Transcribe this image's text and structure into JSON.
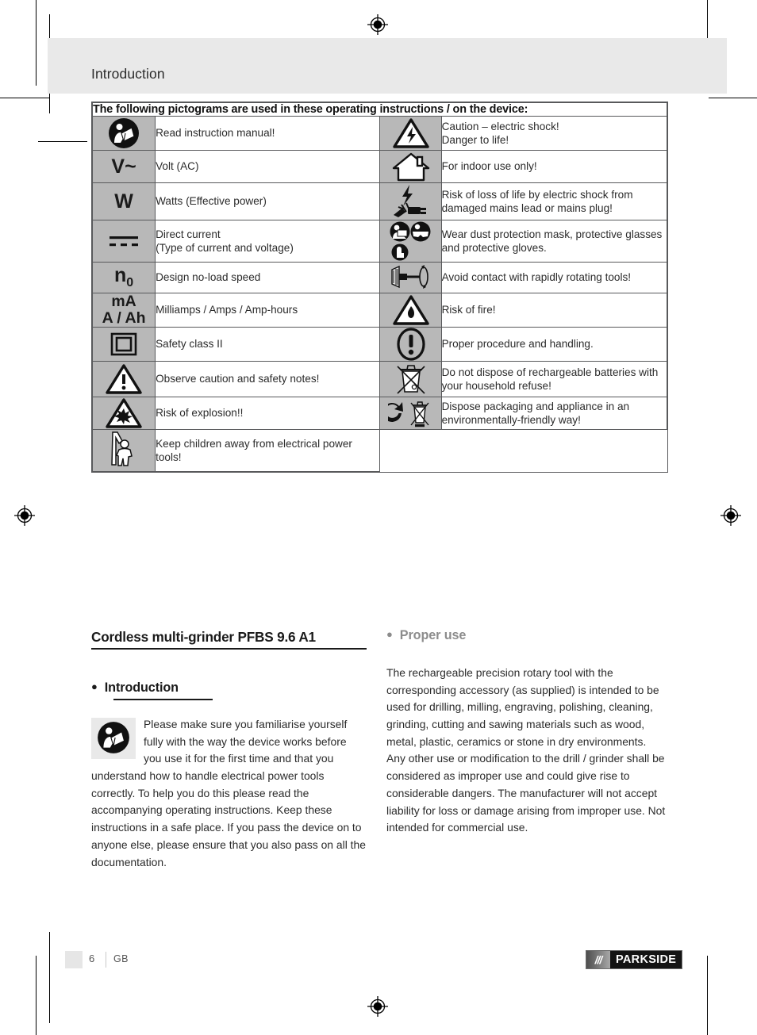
{
  "page": {
    "running_head": "Introduction",
    "footer": {
      "page_number": "6",
      "language": "GB",
      "brand_slashes": "///",
      "brand_name": "PARKSIDE"
    }
  },
  "pictogram_table": {
    "caption": "The following pictograms are used in these operating instructions / on the device:",
    "rows": [
      {
        "left_icon": "read-manual-icon",
        "left_symbol": "",
        "left_text": "Read instruction manual!",
        "right_icon": "electric-shock-warning-icon",
        "right_text": "Caution – electric shock!\nDanger to life!"
      },
      {
        "left_icon": "volt-ac-symbol",
        "left_symbol": "V~",
        "left_text": "Volt (AC)",
        "right_icon": "indoor-use-only-icon",
        "right_text": "For indoor use only!"
      },
      {
        "left_icon": "watts-symbol",
        "left_symbol": "W",
        "left_text": "Watts (Effective power)",
        "right_icon": "damaged-mains-lead-icon",
        "right_text": "Risk of loss of life by electric shock from damaged mains lead or mains plug!"
      },
      {
        "left_icon": "direct-current-symbol",
        "left_symbol": "",
        "left_text": "Direct current\n(Type of current and voltage)",
        "right_icon": "wear-protection-icon",
        "right_text": "Wear dust protection mask, protective glasses and protective gloves."
      },
      {
        "left_icon": "no-load-speed-symbol",
        "left_symbol": "n0",
        "left_text": "Design no-load speed",
        "right_icon": "rotating-tool-warning-icon",
        "right_text": "Avoid contact with rapidly rotating tools!"
      },
      {
        "left_icon": "milliamps-symbol",
        "left_symbol": "mA A / Ah",
        "left_text": "Milliamps / Amps / Amp-hours",
        "right_icon": "fire-risk-icon",
        "right_text": "Risk of fire!"
      },
      {
        "left_icon": "safety-class-two-icon",
        "left_symbol": "",
        "left_text": "Safety class II",
        "right_icon": "proper-handling-icon",
        "right_text": "Proper procedure and handling."
      },
      {
        "left_icon": "general-warning-icon",
        "left_symbol": "",
        "left_text": "Observe caution and safety notes!",
        "right_icon": "no-household-battery-disposal-icon",
        "right_text": "Do not dispose of rechargeable batteries with your household refuse!"
      },
      {
        "left_icon": "explosion-risk-icon",
        "left_symbol": "",
        "left_text": "Risk of explosion!!",
        "right_icon": "environmental-disposal-icon",
        "right_text": "Dispose packaging and appliance in an environmentally-friendly way!"
      },
      {
        "left_icon": "keep-children-away-icon",
        "left_symbol": "",
        "left_text": "Keep children away from electrical power tools!",
        "right_icon": "",
        "right_text": ""
      }
    ]
  },
  "content": {
    "product_title": "Cordless multi-grinder PFBS 9.6 A1",
    "left_section": {
      "bullet": "●",
      "heading": "Introduction",
      "icon": "read-manual-icon",
      "body": "Please make sure you familiarise yourself fully with the way the device works before you use it for the first time and that you understand how to handle electrical power tools correctly. To help you do this please read the accompanying operating instructions. Keep these instructions in a safe place. If you pass the device on to anyone else, please ensure that you also pass on all the documentation."
    },
    "right_section": {
      "bullet": "●",
      "heading": "Proper use",
      "heading_color": "#8c8c8c",
      "body": "The rechargeable precision rotary tool with the corresponding accessory (as supplied) is intended to be used for drilling, milling, engraving, polishing, cleaning, grinding, cutting and sawing materials such as wood, metal, plastic, ceramics or stone in dry environments. Any other use or modification to the drill / grinder shall be considered as improper use and could give rise to considerable dangers. The manufacturer will not accept liability for loss or damage arising from improper use. Not intended for commercial use."
    }
  },
  "colors": {
    "band": "#e9e9e9",
    "icon_cell": "#b8b8b8",
    "rule": "#58595b",
    "text": "#2b2b2b"
  }
}
